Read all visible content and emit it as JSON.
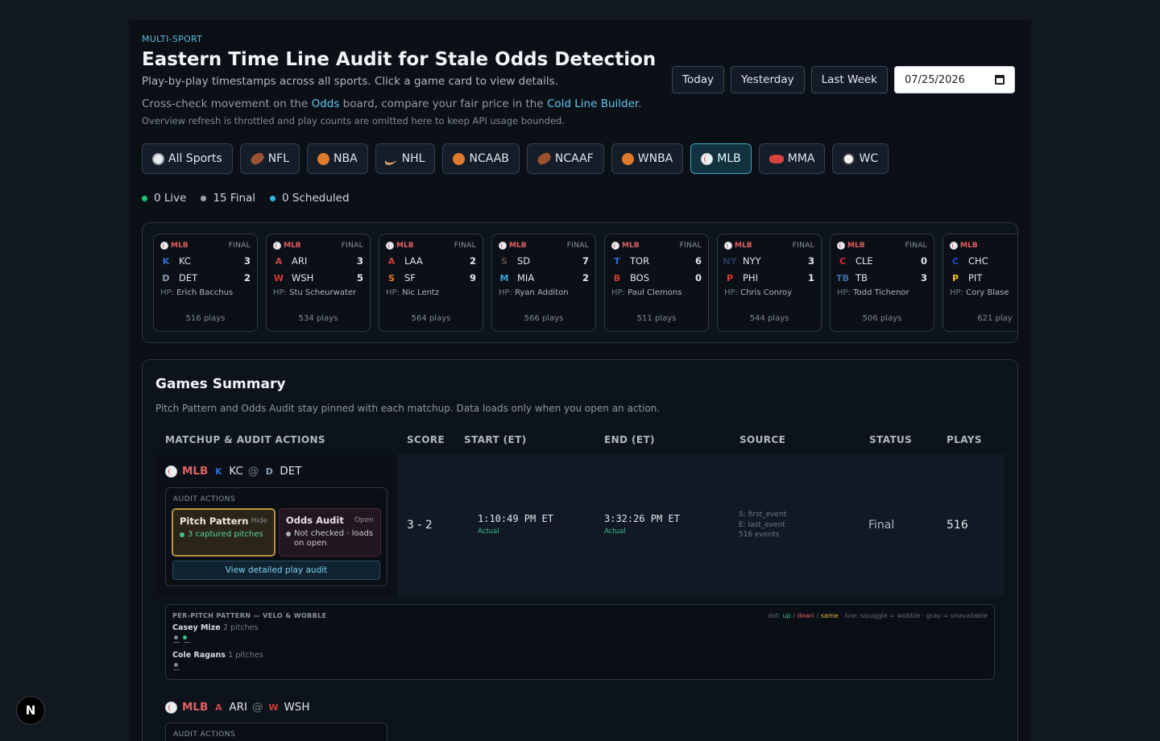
{
  "header": {
    "kicker": "MULTI-SPORT",
    "title": "Eastern Time Line Audit for Stale Odds Detection",
    "subtitle": "Play-by-play timestamps across all sports. Click a game card to view details.",
    "crosscheck_pre": "Cross-check movement on the ",
    "crosscheck_link1": "Odds",
    "crosscheck_mid": " board, compare your fair price in the ",
    "crosscheck_link2": "Cold Line Builder",
    "crosscheck_post": ".",
    "throttle_note": "Overview refresh is throttled and play counts are omitted here to keep API usage bounded."
  },
  "date_controls": {
    "today": "Today",
    "yesterday": "Yesterday",
    "last_week": "Last Week",
    "date_value": "07/25/2026"
  },
  "sports": [
    {
      "label": "All Sports",
      "icon": "globe-icon"
    },
    {
      "label": "NFL",
      "icon": "football-icon"
    },
    {
      "label": "NBA",
      "icon": "basketball-icon"
    },
    {
      "label": "NHL",
      "icon": "hockey-stick-icon"
    },
    {
      "label": "NCAAB",
      "icon": "basketball-icon"
    },
    {
      "label": "NCAAF",
      "icon": "football-icon"
    },
    {
      "label": "WNBA",
      "icon": "basketball-icon"
    },
    {
      "label": "MLB",
      "icon": "baseball-icon",
      "active": true
    },
    {
      "label": "MMA",
      "icon": "boxing-glove-icon"
    },
    {
      "label": "WC",
      "icon": "soccer-ball-icon"
    }
  ],
  "counts": {
    "live": "0 Live",
    "final": "15 Final",
    "scheduled": "0 Scheduled",
    "colors": {
      "live": "#22c07a",
      "final": "#9aa3ad",
      "scheduled": "#33b6e0"
    }
  },
  "cards": [
    {
      "league": "MLB",
      "status": "FINAL",
      "away": {
        "abbr": "KC",
        "score": "3",
        "color": "#2e6fd0",
        "mark": "K"
      },
      "home": {
        "abbr": "DET",
        "score": "2",
        "color": "#8a9bb0",
        "mark": "D"
      },
      "hp_label": "HP:",
      "hp": "Erich Bacchus",
      "plays": "516 plays"
    },
    {
      "league": "MLB",
      "status": "FINAL",
      "away": {
        "abbr": "ARI",
        "score": "3",
        "color": "#c24a4a",
        "mark": "A"
      },
      "home": {
        "abbr": "WSH",
        "score": "5",
        "color": "#d03a3a",
        "mark": "W"
      },
      "hp_label": "HP:",
      "hp": "Stu Scheurwater",
      "plays": "534 plays"
    },
    {
      "league": "MLB",
      "status": "FINAL",
      "away": {
        "abbr": "LAA",
        "score": "2",
        "color": "#d03a3a",
        "mark": "A"
      },
      "home": {
        "abbr": "SF",
        "score": "9",
        "color": "#f07a2a",
        "mark": "S"
      },
      "hp_label": "HP:",
      "hp": "Nic Lentz",
      "plays": "564 plays"
    },
    {
      "league": "MLB",
      "status": "FINAL",
      "away": {
        "abbr": "SD",
        "score": "7",
        "color": "#5a4a3a",
        "mark": "S"
      },
      "home": {
        "abbr": "MIA",
        "score": "2",
        "color": "#3aa8d8",
        "mark": "M"
      },
      "hp_label": "HP:",
      "hp": "Ryan Additon",
      "plays": "566 plays"
    },
    {
      "league": "MLB",
      "status": "FINAL",
      "away": {
        "abbr": "TOR",
        "score": "6",
        "color": "#2a6ad0",
        "mark": "T"
      },
      "home": {
        "abbr": "BOS",
        "score": "0",
        "color": "#d03a3a",
        "mark": "B"
      },
      "hp_label": "HP:",
      "hp": "Paul Clemons",
      "plays": "511 plays"
    },
    {
      "league": "MLB",
      "status": "FINAL",
      "away": {
        "abbr": "NYY",
        "score": "3",
        "color": "#22365a",
        "mark": "NY"
      },
      "home": {
        "abbr": "PHI",
        "score": "1",
        "color": "#e03a3a",
        "mark": "P"
      },
      "hp_label": "HP:",
      "hp": "Chris Conroy",
      "plays": "544 plays"
    },
    {
      "league": "MLB",
      "status": "FINAL",
      "away": {
        "abbr": "CLE",
        "score": "0",
        "color": "#e0303a",
        "mark": "C"
      },
      "home": {
        "abbr": "TB",
        "score": "3",
        "color": "#3a6aa8",
        "mark": "TB"
      },
      "hp_label": "HP:",
      "hp": "Todd Tichenor",
      "plays": "506 plays"
    },
    {
      "league": "MLB",
      "status": "",
      "away": {
        "abbr": "CHC",
        "score": "",
        "color": "#2a4ad0",
        "mark": "C"
      },
      "home": {
        "abbr": "PIT",
        "score": "",
        "color": "#f0c020",
        "mark": "P"
      },
      "hp_label": "HP:",
      "hp": "Cory Blase",
      "plays": "621 play"
    }
  ],
  "summary": {
    "title": "Games Summary",
    "subtitle": "Pitch Pattern and Odds Audit stay pinned with each matchup. Data loads only when you open an action.",
    "columns": {
      "matchup": "MATCHUP & AUDIT ACTIONS",
      "score": "SCORE",
      "start": "START (ET)",
      "end": "END (ET)",
      "source": "SOURCE",
      "status": "STATUS",
      "plays": "PLAYS"
    },
    "games": [
      {
        "league": "MLB",
        "away": "KC",
        "at": "@",
        "home": "DET",
        "audit_label": "AUDIT ACTIONS",
        "pitch_title": "Pitch Pattern",
        "pitch_toggle": "Hide",
        "pitch_detail": "3 captured pitches",
        "odds_title": "Odds Audit",
        "odds_toggle": "Open",
        "odds_detail": "Not checked · loads on open",
        "view_button": "View detailed play audit",
        "score": "3 - 2",
        "start": "1:10:49 PM ET",
        "start_note": "Actual",
        "end": "3:32:26 PM ET",
        "end_note": "Actual",
        "source_start": "S: first_event",
        "source_end": "E: last_event",
        "source_events": "516 events",
        "status": "Final",
        "plays": "516"
      },
      {
        "league": "MLB",
        "away": "ARI",
        "at": "@",
        "home": "WSH",
        "audit_label": "AUDIT ACTIONS"
      }
    ],
    "pattern": {
      "label": "PER-PITCH PATTERN — VELO & WOBBLE",
      "legend_prefix": "dot:",
      "legend_up": "up",
      "legend_sep1": "/",
      "legend_down": "down",
      "legend_sep2": "/",
      "legend_same": "same",
      "legend_suffix": "· line: squiggle = wobble · gray = unavailable",
      "pitchers": [
        {
          "name": "Casey Mize",
          "count": "2 pitches",
          "dots": [
            "#7d8896",
            "#42c48a"
          ]
        },
        {
          "name": "Cole Ragans",
          "count": "1 pitches",
          "dots": [
            "#7d8896"
          ]
        }
      ]
    }
  },
  "badge": "N"
}
